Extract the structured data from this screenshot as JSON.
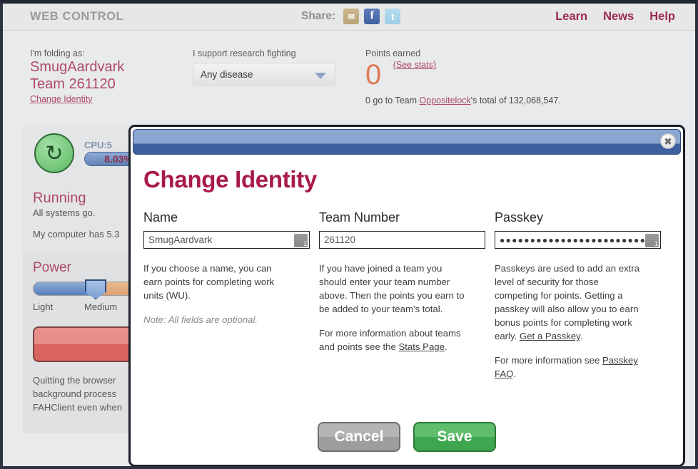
{
  "header": {
    "brand": "WEB CONTROL",
    "share_label": "Share:",
    "share_icons": [
      {
        "name": "email-share-icon",
        "glyph": "✉"
      },
      {
        "name": "facebook-share-icon",
        "glyph": "f"
      },
      {
        "name": "twitter-share-icon",
        "glyph": "t"
      }
    ],
    "nav": [
      {
        "label": "Learn"
      },
      {
        "label": "News"
      },
      {
        "label": "Help"
      }
    ],
    "link_color": "#9b2b4a"
  },
  "identity": {
    "folding_label": "I'm folding as:",
    "user_name": "SmugAardvark",
    "team_line": "Team 261120",
    "change_identity": "Change Identity",
    "disease_label": "I support research fighting",
    "disease_selected": "Any disease",
    "points_label": "Points earned",
    "points_value": "0",
    "see_stats": "(See stats)",
    "note_prefix": "0 go to Team ",
    "note_team": "Oppositelock",
    "note_suffix": "'s total of 132,068,547."
  },
  "status": {
    "cpu_label": "CPU:5",
    "cpu_percent": "8.03%",
    "refresh_icon": "↻",
    "state_title": "Running",
    "state_sub": "All systems go.",
    "computer_line": "My computer has 5.3",
    "power_title": "Power",
    "power_min": "Light",
    "power_current": "Medium",
    "quit_note": "Quitting the browser\nbackground process\nFAHClient even when"
  },
  "modal": {
    "title": "Change Identity",
    "close_glyph": "✖",
    "columns": [
      {
        "label": "Name",
        "value": "SmugAardvark",
        "masked": false,
        "has_pw_icon": true,
        "help": [
          "If you choose a name, you can earn points for completing work units (WU)."
        ],
        "note": "Note: All fields are optional."
      },
      {
        "label": "Team Number",
        "value": "261120",
        "masked": false,
        "has_pw_icon": false,
        "help": [
          "If you have joined a team you should enter your team number above. Then the points you earn to be added to your team's total.",
          "For more information about teams and points see the Stats Page."
        ],
        "link1": "Stats Page"
      },
      {
        "label": "Passkey",
        "value": "●●●●●●●●●●●●●●●●●●●●●●●●",
        "masked": true,
        "has_pw_icon": true,
        "help": [
          "Passkeys are used to add an extra level of security for those competing for points. Getting a passkey will also allow you to earn bonus points for completing work early. Get a Passkey.",
          "For more information see Passkey FAQ."
        ],
        "link1": "Get a Passkey",
        "link2": "Passkey FAQ"
      }
    ],
    "cancel_label": "Cancel",
    "save_label": "Save",
    "title_color": "#a8194a",
    "save_color": "#3ea64f"
  }
}
